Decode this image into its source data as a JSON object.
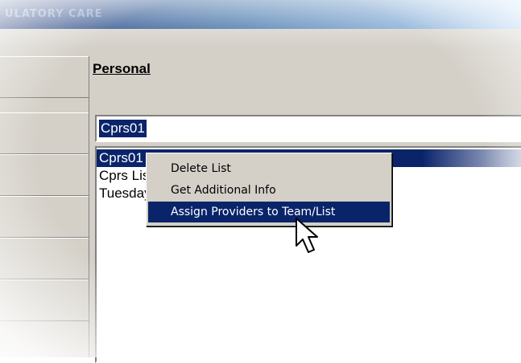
{
  "window": {
    "title": "ULATORY CARE"
  },
  "panel": {
    "heading": "Personal"
  },
  "name_input": {
    "value": "Cprs01"
  },
  "list": {
    "items": [
      {
        "label": "Cprs01",
        "selected": true
      },
      {
        "label": "Cprs List",
        "selected": false
      },
      {
        "label": "Tuesday",
        "selected": false
      }
    ]
  },
  "context_menu": {
    "items": [
      {
        "label": "Delete List",
        "active": false
      },
      {
        "label": "Get Additional Info",
        "active": false
      },
      {
        "label": "Assign Providers to Team/List",
        "active": true
      }
    ]
  },
  "colors": {
    "selection": "#0a246a",
    "face": "#d4d0c8"
  },
  "icons": {
    "cursor": "arrow-pointer-icon"
  }
}
